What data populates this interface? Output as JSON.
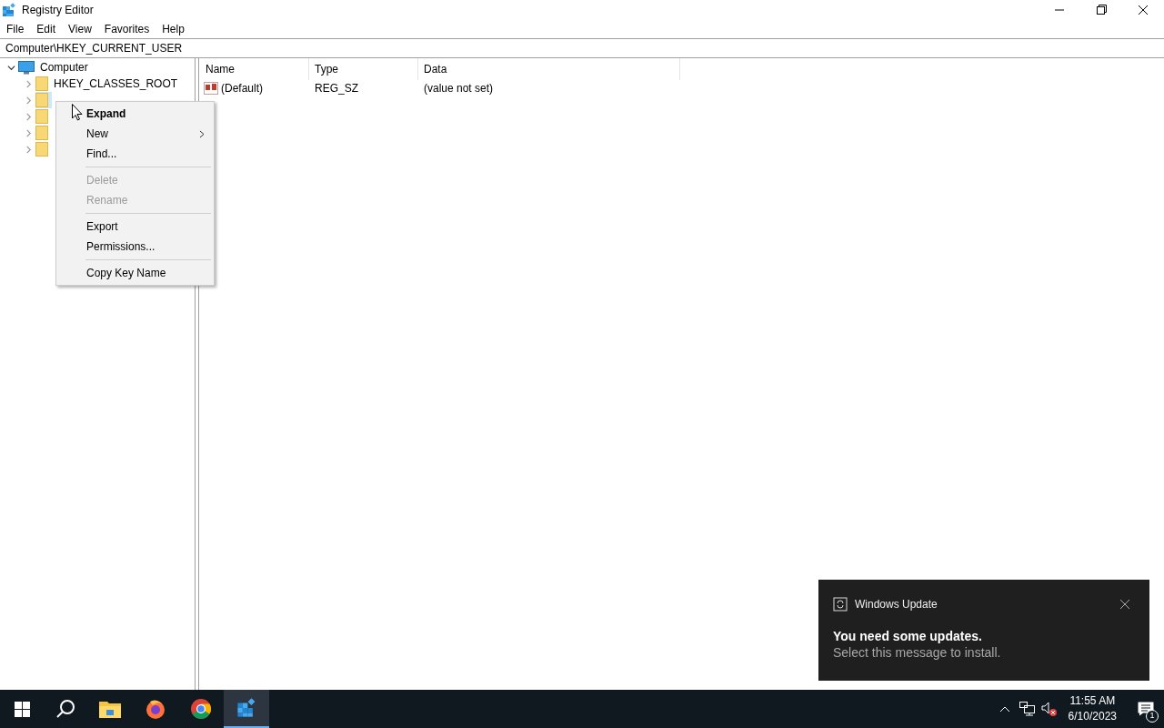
{
  "window": {
    "title": "Registry Editor"
  },
  "menu_bar": [
    "File",
    "Edit",
    "View",
    "Favorites",
    "Help"
  ],
  "address": "Computer\\HKEY_CURRENT_USER",
  "tree": [
    {
      "label": "Computer",
      "kind": "computer",
      "expanded": true,
      "selected": false,
      "children": [
        {
          "label": "HKEY_CLASSES_ROOT",
          "kind": "folder",
          "expanded": false,
          "selected": false
        },
        {
          "kind": "folder",
          "expanded": false,
          "selected": true
        },
        {
          "kind": "folder",
          "expanded": false,
          "selected": false
        },
        {
          "kind": "folder",
          "expanded": false,
          "selected": false
        },
        {
          "kind": "folder",
          "expanded": false,
          "selected": false
        }
      ]
    }
  ],
  "table": {
    "columns": [
      "Name",
      "Type",
      "Data"
    ],
    "rows": [
      {
        "name": "(Default)",
        "type": "REG_SZ",
        "data": "(value not set)"
      }
    ]
  },
  "context_menu": [
    {
      "kind": "item",
      "label": "Expand",
      "default": true,
      "disabled": false,
      "submenu": false
    },
    {
      "kind": "item",
      "label": "New",
      "default": false,
      "disabled": false,
      "submenu": true
    },
    {
      "kind": "item",
      "label": "Find...",
      "default": false,
      "disabled": false,
      "submenu": false
    },
    {
      "kind": "separator"
    },
    {
      "kind": "item",
      "label": "Delete",
      "default": false,
      "disabled": true,
      "submenu": false
    },
    {
      "kind": "item",
      "label": "Rename",
      "default": false,
      "disabled": true,
      "submenu": false
    },
    {
      "kind": "separator"
    },
    {
      "kind": "item",
      "label": "Export",
      "default": false,
      "disabled": false,
      "submenu": false
    },
    {
      "kind": "item",
      "label": "Permissions...",
      "default": false,
      "disabled": false,
      "submenu": false
    },
    {
      "kind": "separator"
    },
    {
      "kind": "item",
      "label": "Copy Key Name",
      "default": false,
      "disabled": false,
      "submenu": false
    }
  ],
  "toast": {
    "app": "Windows Update",
    "title": "You need some updates.",
    "message": "Select this message to install."
  },
  "taskbar": {
    "apps": [
      {
        "kind": "explorer",
        "active": false
      },
      {
        "kind": "firefox",
        "active": false
      },
      {
        "kind": "chrome",
        "active": false
      },
      {
        "kind": "regedit",
        "active": true
      }
    ],
    "time": "11:55 AM",
    "date": "6/10/2023",
    "notifications": "1"
  }
}
